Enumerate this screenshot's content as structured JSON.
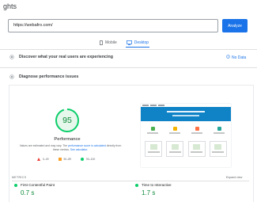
{
  "header": {
    "title": "ghts"
  },
  "search": {
    "url_value": "https://webafro.com/",
    "analyze_label": "Analyze"
  },
  "tabs": [
    {
      "label": "Mobile",
      "icon": "mobile-icon",
      "active": false
    },
    {
      "label": "Desktop",
      "icon": "desktop-icon",
      "active": true
    }
  ],
  "sections": {
    "discover": {
      "label": "Discover what your real users are experiencing",
      "no_data_label": "No Data"
    },
    "diagnose": {
      "label": "Diagnose performance issues"
    }
  },
  "performance": {
    "score": "95",
    "score_fraction": 0.95,
    "title": "Performance",
    "note_prefix": "Values are estimated and may vary. The ",
    "note_link1": "performance score is calculated",
    "note_middle": " directly from these metrics. ",
    "note_link2": "See calculator."
  },
  "legend": [
    {
      "label": "0–49",
      "shape": "triangle",
      "color": "#eb3a32"
    },
    {
      "label": "50–89",
      "shape": "square",
      "color": "#fa9f25"
    },
    {
      "label": "90–100",
      "shape": "circle",
      "color": "#0cce6b"
    }
  ],
  "metrics": {
    "section_label": "METRICS",
    "expand_label": "Expand view",
    "items": [
      {
        "name": "First Contentful Paint",
        "value": "0.7 s",
        "status_color": "#0cce6b"
      },
      {
        "name": "Time to Interactive",
        "value": "1.7 s",
        "status_color": "#0cce6b"
      }
    ]
  },
  "colors": {
    "accent": "#1a73e8",
    "good": "#0cce6b",
    "good_text": "#0d8a39"
  }
}
